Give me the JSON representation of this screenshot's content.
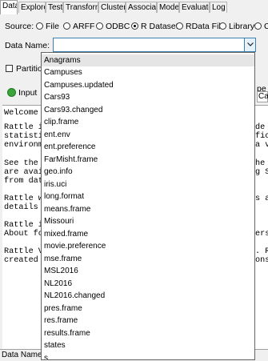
{
  "tabs": [
    "Data",
    "Explore",
    "Test",
    "Transform",
    "Cluster",
    "Associate",
    "Model",
    "Evaluate",
    "Log"
  ],
  "source": {
    "label": "Source:",
    "options": [
      "File",
      "ARFF",
      "ODBC",
      "R Dataset",
      "RData File",
      "Library",
      "C"
    ],
    "selected": "R Dataset"
  },
  "data_name": {
    "label": "Data Name:",
    "value": ""
  },
  "partition_label": "Partition",
  "input_label": "Input",
  "right_fragments": {
    "type_header": "pe",
    "cat_cell": "Cat"
  },
  "textarea_lines": [
    "Welcome t",
    "Rattle is",
    "statistic",
    "environme",
    "See the F",
    "are avail",
    "from data",
    "Rattle wo",
    "details f",
    "Rattle is",
    "About for",
    "Rattle Ve",
    "created a"
  ],
  "textarea_right_fragments": [
    "de",
    "fic",
    "a v",
    "he R",
    "g S",
    "s a",
    "ersi",
    ". Ra",
    "ons"
  ],
  "dropdown_items": [
    "Anagrams",
    "Campuses",
    "Campuses.updated",
    "Cars93",
    "Cars93.changed",
    "clip.frame",
    "ent.env",
    "ent.preference",
    "FarMisht.frame",
    "geo.info",
    "iris.uci",
    "long.format",
    "means.frame",
    "Missouri",
    "mixed.frame",
    "movie.preference",
    "mse.frame",
    "MSL2016",
    "NL2016",
    "NL2016.changed",
    "pres.frame",
    "res.frame",
    "results.frame",
    "states",
    "s"
  ],
  "highlighted_item": "Anagrams",
  "status_text": "Data Names u",
  "colors": {
    "accent_border": "#3c7fb1",
    "input_green": "#3aa53a",
    "highlight": "#e5e5e5"
  }
}
